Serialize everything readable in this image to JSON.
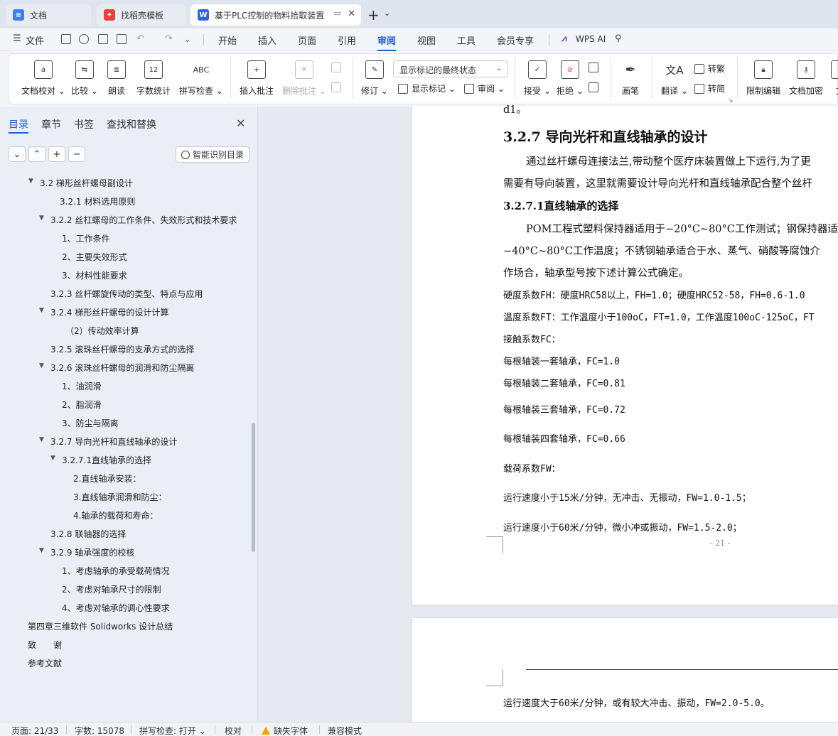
{
  "tabs": [
    {
      "label": "文档",
      "icon": "doc-icon"
    },
    {
      "label": "找稻壳模板",
      "icon": "daoke-icon"
    },
    {
      "label": "基于PLC控制的物料拾取装置",
      "icon": "word-icon"
    }
  ],
  "file_menu": "文件",
  "menu": [
    "开始",
    "插入",
    "页面",
    "引用",
    "审阅",
    "视图",
    "工具",
    "会员专享"
  ],
  "wps_ai": "WPS AI",
  "ribbon": {
    "doc_check": "文档校对",
    "compare": "比较",
    "read_aloud": "朗读",
    "word_count": "字数统计",
    "word_count_icon": "12",
    "spell_check": "拼写检查",
    "spell_icon": "ABC",
    "insert_comment": "插入批注",
    "delete_comment": "删除批注",
    "revise": "修订",
    "markup_select": "显示标记的最终状态",
    "show_markup": "显示标记",
    "review_pane": "审阅",
    "accept": "接受",
    "reject": "拒绝",
    "pen": "画笔",
    "translate": "翻译",
    "to_traditional": "转繁",
    "to_simplified": "转简",
    "restrict_edit": "限制编辑",
    "encrypt": "文档加密",
    "more": "文"
  },
  "nav": {
    "tabs": [
      "目录",
      "章节",
      "书签",
      "查找和替换"
    ],
    "smart_toc": "智能识别目录",
    "items": [
      "3.2 梯形丝杆螺母副设计",
      "3.2.1 材料选用原则",
      "3.2.2 丝杠螺母的工作条件、失效形式和技术要求",
      "1、工作条件",
      "2、主要失效形式",
      "3、材料性能要求",
      "3.2.3 丝杆螺旋传动的类型、特点与应用",
      "3.2.4 梯形丝杆螺母的设计计算",
      "（2）传动效率计算",
      "3.2.5 滚珠丝杆螺母的支承方式的选择",
      "3.2.6 滚珠丝杆螺母的润滑和防尘隔离",
      "1、油润滑",
      "2、脂润滑",
      "3、防尘与隔离",
      "3.2.7 导向光杆和直线轴承的设计",
      "3.2.7.1直线轴承的选择",
      "2.直线轴承安装：",
      "3.直线轴承润滑和防尘：",
      "4.轴承的载荷和寿命：",
      "3.2.8 联轴器的选择",
      "3.2.9 轴承强度的校核",
      "1、考虑轴承的承受载荷情况",
      "2、考虑对轴承尺寸的限制",
      "4、考虑对轴承的调心性要求",
      "第四章三维软件 Solidworks 设计总结",
      "致　　谢",
      "参考文献"
    ]
  },
  "doc": {
    "top_fragment": "d1。",
    "heading": "3.2.7 导向光杆和直线轴承的设计",
    "para1_line1": "通过丝杆螺母连接法兰,带动整个医疗床装置做上下运行,为了更",
    "para1_line2": "需要有导向装置，这里就需要设计导向光杆和直线轴承配合整个丝杆",
    "subheading": "3.2.7.1直线轴承的选择",
    "para2_line1": "POM工程式塑料保持器适用于−20°C~80°C工作测试；钢保持器适",
    "para2_line2": "−40°C~80°C工作温度；不锈钢轴承适合于水、蒸气、硝酸等腐蚀介",
    "para2_line3": "作场合，轴承型号按下述计算公式确定。",
    "fh": "硬度系数FH：硬度HRC58以上，FH=1.0；硬度HRC52-58，FH=0.6-1.0",
    "ft": "温度系数FT：工作温度小于100oC，FT=1.0，工作温度100oC-125oC，FT",
    "fc": "接触系数FC：",
    "fc1": "每根轴装一套轴承，FC=1.0",
    "fc2": "每根轴装二套轴承，FC=0.81",
    "fc3": "每根轴装三套轴承，FC=0.72",
    "fc4": "每根轴装四套轴承，FC=0.66",
    "fw": "载荷系数FW：",
    "fw1": "运行速度小于15米/分钟，无冲击、无振动，FW=1.0-1.5；",
    "fw2": "运行速度小于60米/分钟，微小冲或振动，FW=1.5-2.0；",
    "page_number": "- 21 -",
    "fw3": "运行速度大于60米/分钟，或有较大冲击、振动，FW=2.0-5.0。"
  },
  "status": {
    "page": "页面: 21/33",
    "words": "字数: 15078",
    "spell": "拼写检查: 打开",
    "proof": "校对",
    "missing_font": "缺失字体",
    "compat": "兼容模式"
  }
}
